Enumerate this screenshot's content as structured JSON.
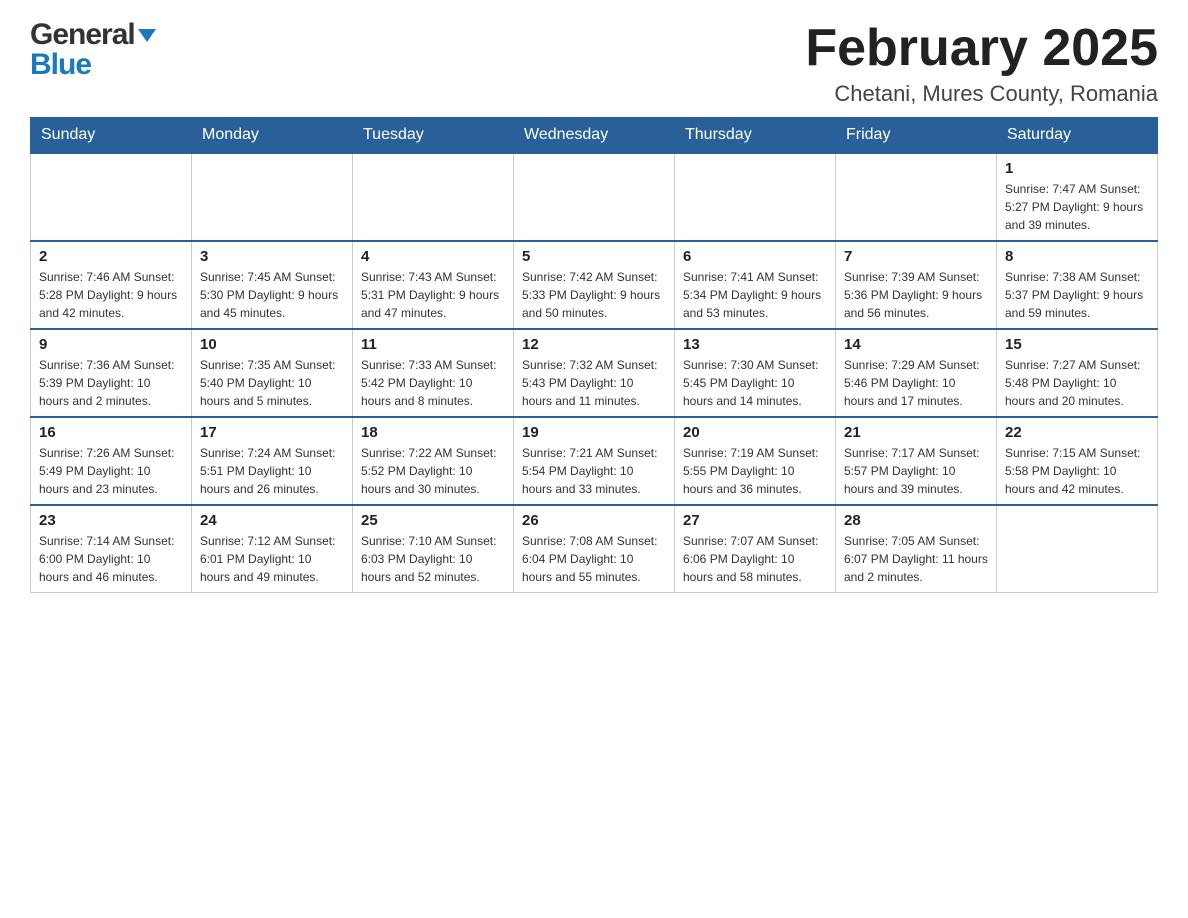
{
  "header": {
    "logo_general": "General",
    "logo_blue": "Blue",
    "month_year": "February 2025",
    "location": "Chetani, Mures County, Romania"
  },
  "days_of_week": [
    "Sunday",
    "Monday",
    "Tuesday",
    "Wednesday",
    "Thursday",
    "Friday",
    "Saturday"
  ],
  "weeks": [
    [
      {
        "day": "",
        "info": "",
        "empty": true
      },
      {
        "day": "",
        "info": "",
        "empty": true
      },
      {
        "day": "",
        "info": "",
        "empty": true
      },
      {
        "day": "",
        "info": "",
        "empty": true
      },
      {
        "day": "",
        "info": "",
        "empty": true
      },
      {
        "day": "",
        "info": "",
        "empty": true
      },
      {
        "day": "1",
        "info": "Sunrise: 7:47 AM\nSunset: 5:27 PM\nDaylight: 9 hours\nand 39 minutes.",
        "empty": false
      }
    ],
    [
      {
        "day": "2",
        "info": "Sunrise: 7:46 AM\nSunset: 5:28 PM\nDaylight: 9 hours\nand 42 minutes.",
        "empty": false
      },
      {
        "day": "3",
        "info": "Sunrise: 7:45 AM\nSunset: 5:30 PM\nDaylight: 9 hours\nand 45 minutes.",
        "empty": false
      },
      {
        "day": "4",
        "info": "Sunrise: 7:43 AM\nSunset: 5:31 PM\nDaylight: 9 hours\nand 47 minutes.",
        "empty": false
      },
      {
        "day": "5",
        "info": "Sunrise: 7:42 AM\nSunset: 5:33 PM\nDaylight: 9 hours\nand 50 minutes.",
        "empty": false
      },
      {
        "day": "6",
        "info": "Sunrise: 7:41 AM\nSunset: 5:34 PM\nDaylight: 9 hours\nand 53 minutes.",
        "empty": false
      },
      {
        "day": "7",
        "info": "Sunrise: 7:39 AM\nSunset: 5:36 PM\nDaylight: 9 hours\nand 56 minutes.",
        "empty": false
      },
      {
        "day": "8",
        "info": "Sunrise: 7:38 AM\nSunset: 5:37 PM\nDaylight: 9 hours\nand 59 minutes.",
        "empty": false
      }
    ],
    [
      {
        "day": "9",
        "info": "Sunrise: 7:36 AM\nSunset: 5:39 PM\nDaylight: 10 hours\nand 2 minutes.",
        "empty": false
      },
      {
        "day": "10",
        "info": "Sunrise: 7:35 AM\nSunset: 5:40 PM\nDaylight: 10 hours\nand 5 minutes.",
        "empty": false
      },
      {
        "day": "11",
        "info": "Sunrise: 7:33 AM\nSunset: 5:42 PM\nDaylight: 10 hours\nand 8 minutes.",
        "empty": false
      },
      {
        "day": "12",
        "info": "Sunrise: 7:32 AM\nSunset: 5:43 PM\nDaylight: 10 hours\nand 11 minutes.",
        "empty": false
      },
      {
        "day": "13",
        "info": "Sunrise: 7:30 AM\nSunset: 5:45 PM\nDaylight: 10 hours\nand 14 minutes.",
        "empty": false
      },
      {
        "day": "14",
        "info": "Sunrise: 7:29 AM\nSunset: 5:46 PM\nDaylight: 10 hours\nand 17 minutes.",
        "empty": false
      },
      {
        "day": "15",
        "info": "Sunrise: 7:27 AM\nSunset: 5:48 PM\nDaylight: 10 hours\nand 20 minutes.",
        "empty": false
      }
    ],
    [
      {
        "day": "16",
        "info": "Sunrise: 7:26 AM\nSunset: 5:49 PM\nDaylight: 10 hours\nand 23 minutes.",
        "empty": false
      },
      {
        "day": "17",
        "info": "Sunrise: 7:24 AM\nSunset: 5:51 PM\nDaylight: 10 hours\nand 26 minutes.",
        "empty": false
      },
      {
        "day": "18",
        "info": "Sunrise: 7:22 AM\nSunset: 5:52 PM\nDaylight: 10 hours\nand 30 minutes.",
        "empty": false
      },
      {
        "day": "19",
        "info": "Sunrise: 7:21 AM\nSunset: 5:54 PM\nDaylight: 10 hours\nand 33 minutes.",
        "empty": false
      },
      {
        "day": "20",
        "info": "Sunrise: 7:19 AM\nSunset: 5:55 PM\nDaylight: 10 hours\nand 36 minutes.",
        "empty": false
      },
      {
        "day": "21",
        "info": "Sunrise: 7:17 AM\nSunset: 5:57 PM\nDaylight: 10 hours\nand 39 minutes.",
        "empty": false
      },
      {
        "day": "22",
        "info": "Sunrise: 7:15 AM\nSunset: 5:58 PM\nDaylight: 10 hours\nand 42 minutes.",
        "empty": false
      }
    ],
    [
      {
        "day": "23",
        "info": "Sunrise: 7:14 AM\nSunset: 6:00 PM\nDaylight: 10 hours\nand 46 minutes.",
        "empty": false
      },
      {
        "day": "24",
        "info": "Sunrise: 7:12 AM\nSunset: 6:01 PM\nDaylight: 10 hours\nand 49 minutes.",
        "empty": false
      },
      {
        "day": "25",
        "info": "Sunrise: 7:10 AM\nSunset: 6:03 PM\nDaylight: 10 hours\nand 52 minutes.",
        "empty": false
      },
      {
        "day": "26",
        "info": "Sunrise: 7:08 AM\nSunset: 6:04 PM\nDaylight: 10 hours\nand 55 minutes.",
        "empty": false
      },
      {
        "day": "27",
        "info": "Sunrise: 7:07 AM\nSunset: 6:06 PM\nDaylight: 10 hours\nand 58 minutes.",
        "empty": false
      },
      {
        "day": "28",
        "info": "Sunrise: 7:05 AM\nSunset: 6:07 PM\nDaylight: 11 hours\nand 2 minutes.",
        "empty": false
      },
      {
        "day": "",
        "info": "",
        "empty": true
      }
    ]
  ]
}
